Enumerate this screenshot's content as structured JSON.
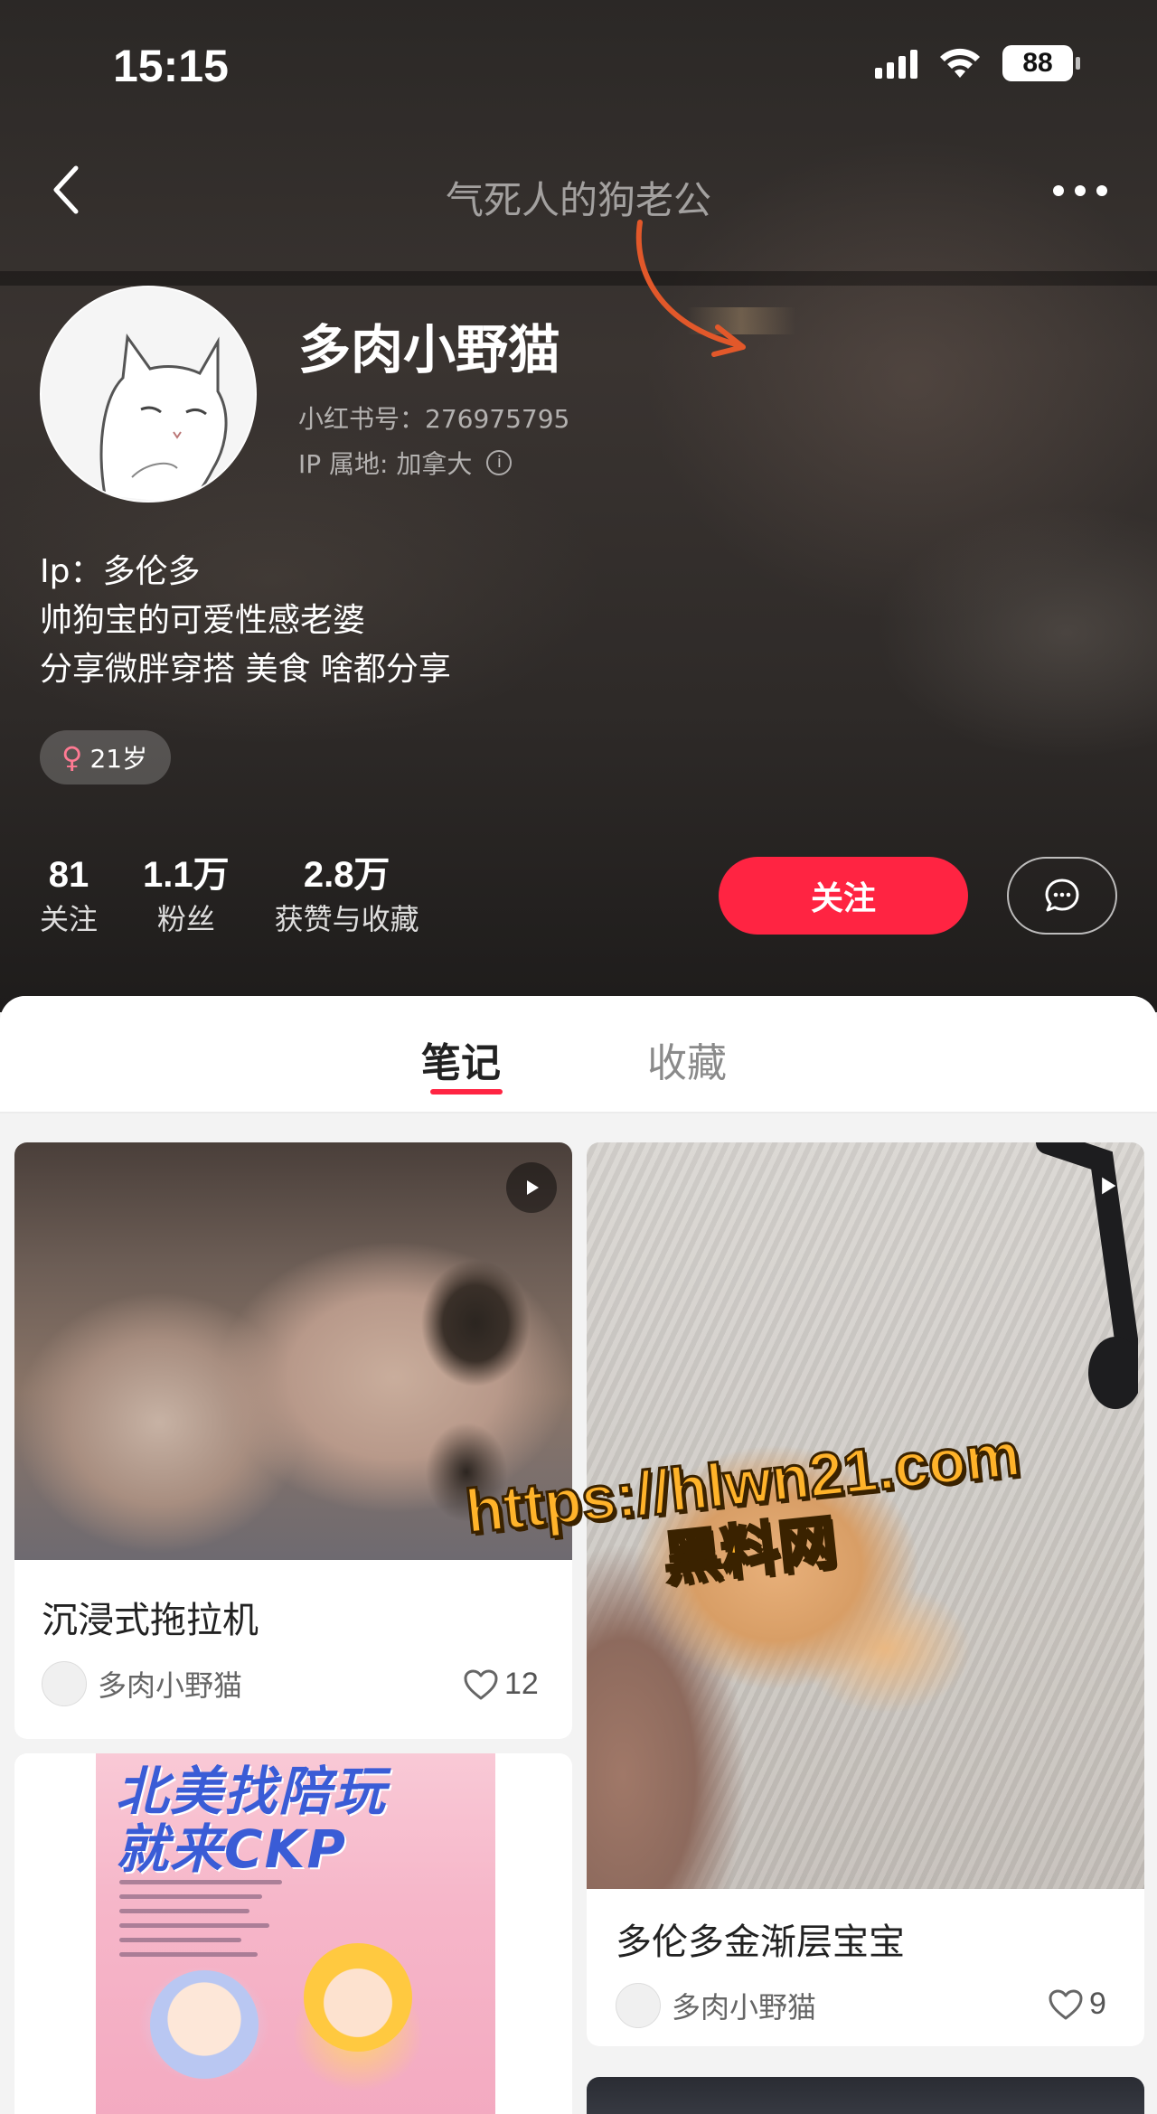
{
  "status_bar": {
    "time": "15:15",
    "battery": "88"
  },
  "nav": {
    "title": "气死人的狗老公"
  },
  "profile": {
    "name": "多肉小野猫",
    "red_id": "小红书号：276975795",
    "ip_location": "IP 属地: 加拿大",
    "bio": [
      "Ip：多伦多",
      "帅狗宝的可爱性感老婆",
      "分享微胖穿搭 美食 啥都分享"
    ],
    "tag": "21岁"
  },
  "stats": [
    {
      "value": "81",
      "label": "关注"
    },
    {
      "value": "1.1万",
      "label": "粉丝"
    },
    {
      "value": "2.8万",
      "label": "获赞与收藏"
    }
  ],
  "actions": {
    "follow": "关注"
  },
  "tabs": [
    {
      "label": "笔记",
      "active": true
    },
    {
      "label": "收藏",
      "active": false
    }
  ],
  "notes": [
    {
      "title": "沉浸式拖拉机",
      "author": "多肉小野猫",
      "likes": "12",
      "video": true
    },
    {
      "title": "多伦多金渐层宝宝",
      "author": "多肉小野猫",
      "likes": "9",
      "video": true
    },
    {
      "poster_text": [
        "北美找陪玩",
        "就来CKP"
      ]
    }
  ],
  "watermark": {
    "line1": "https://hlwn21.com",
    "line2": "黑料网"
  },
  "colors": {
    "accent": "#ff2442",
    "header_bg": "#2e2a28",
    "watermark": "#ffb32a"
  }
}
